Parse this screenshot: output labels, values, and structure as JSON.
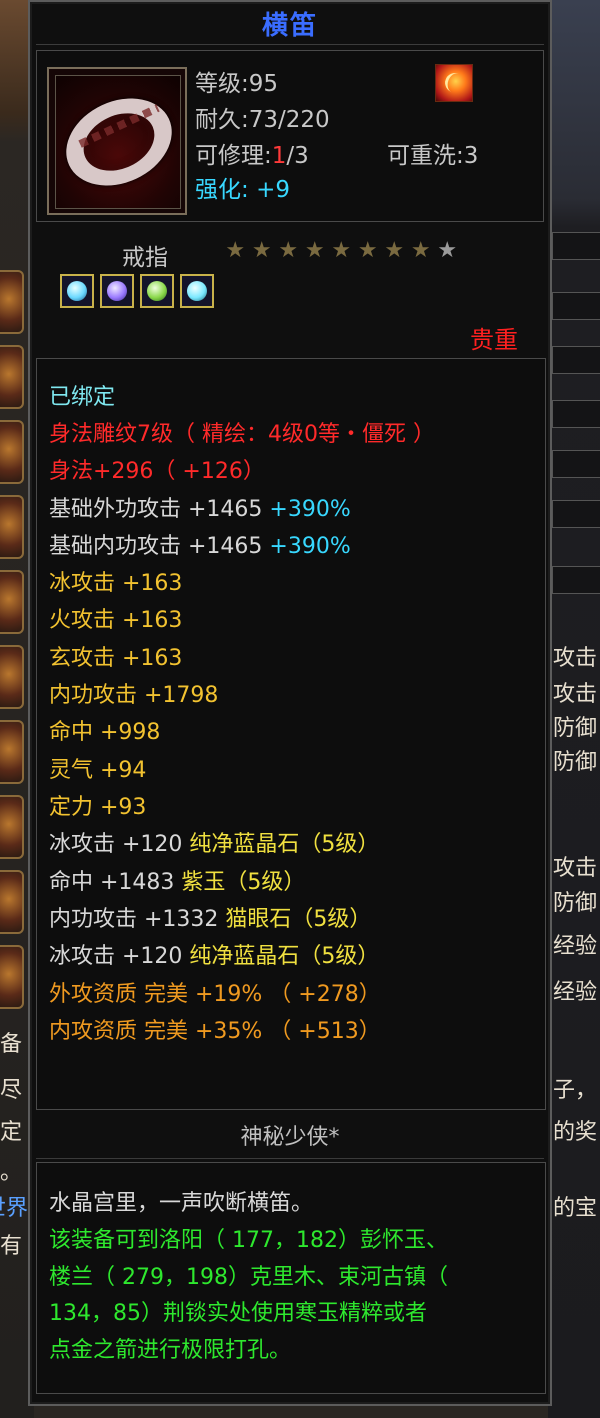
{
  "background": {
    "left_fragments": [
      "备",
      "尽",
      "定",
      "。",
      "世界",
      "有"
    ],
    "right_fragments": [
      "攻击",
      "攻击",
      "防御",
      "防御",
      "攻击",
      "防御",
      "经验",
      "经验",
      "子，",
      "的奖",
      "的宝"
    ]
  },
  "tooltip": {
    "title": "横笛",
    "header": {
      "level_label": "等级",
      "level_value": "95",
      "durability_label": "耐久",
      "durability_value": "73/220",
      "repair_label": "可修理",
      "repair_used": "1",
      "repair_total": "/3",
      "rewash_label": "可重洗",
      "rewash_value": "3",
      "enhance_label": "强化",
      "enhance_value": "+9",
      "item_icon": "silver-ring-icon",
      "badge_icon": "phoenix-badge-icon"
    },
    "item_type": "戒指",
    "stars": {
      "total": 9,
      "lit": 8,
      "glyph": "★"
    },
    "gem_sockets": [
      {
        "icon": "cyan-gem-icon",
        "color": "#6ad8ff"
      },
      {
        "icon": "purple-gem-icon",
        "color": "#9a7aff"
      },
      {
        "icon": "green-gem-icon",
        "color": "#8ad84a"
      },
      {
        "icon": "cyan-gem-icon",
        "color": "#7ae8ff"
      }
    ],
    "quality": "贵重",
    "stats": {
      "bound": "已绑定",
      "engrave": "身法雕纹7级（ 精绘：4级0等・僵死 ）",
      "agility": "身法+296（ +126）",
      "ext_attack": "基础外功攻击  +1465",
      "ext_attack_pct": "+390%",
      "int_attack": "基础内功攻击  +1465",
      "int_attack_pct": "+390%",
      "ice": "冰攻击  +163",
      "fire": "火攻击  +163",
      "mystic": "玄攻击  +163",
      "inner": "内功攻击  +1798",
      "hit": "命中  +998",
      "spirit": "灵气  +94",
      "focus": "定力  +93",
      "gem1_stat": "冰攻击  +120",
      "gem1_name": "纯净蓝晶石（5级）",
      "gem2_stat": "命中  +1483",
      "gem2_name": "紫玉（5级）",
      "gem3_stat": "内功攻击  +1332",
      "gem3_name": "猫眼石（5级）",
      "gem4_stat": "冰攻击  +120",
      "gem4_name": "纯净蓝晶石（5级）",
      "ext_quality": "外攻资质   完美  +19%  （ +278）",
      "int_quality": "内攻资质   完美  +35%  （ +513）"
    },
    "source": "神秘少侠*",
    "description": {
      "flavor": "水晶宫里，一声吹断横笛。",
      "hint_line1": "该装备可到洛阳（ 177，182）彭怀玉、",
      "hint_line2": "楼兰（ 279，198）克里木、束河古镇（",
      "hint_line3": "134，85）荆锬实处使用寒玉精粹或者",
      "hint_line4": "点金之箭进行极限打孔。"
    }
  }
}
